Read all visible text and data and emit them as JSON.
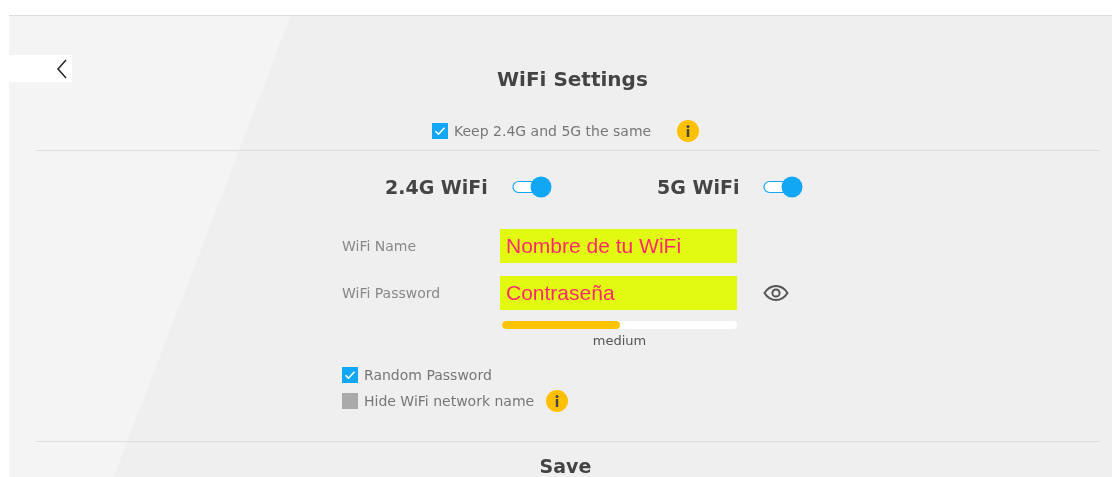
{
  "title": "WiFi Settings",
  "keep_same": {
    "label": "Keep 2.4G and 5G the same",
    "checked": true
  },
  "bands": [
    {
      "label": "2.4G WiFi",
      "on": true
    },
    {
      "label": "5G WiFi",
      "on": true
    }
  ],
  "wifi_name": {
    "label": "WiFi Name",
    "value": "Nombre de tu WiFi"
  },
  "wifi_password": {
    "label": "WiFi Password",
    "value": "Contraseña"
  },
  "strength": {
    "level": 0.5,
    "label": "medium"
  },
  "options": [
    {
      "label": "Random Password",
      "checked": true,
      "info": false
    },
    {
      "label": "Hide WiFi network name",
      "checked": false,
      "info": true
    }
  ],
  "save_button": "Save"
}
